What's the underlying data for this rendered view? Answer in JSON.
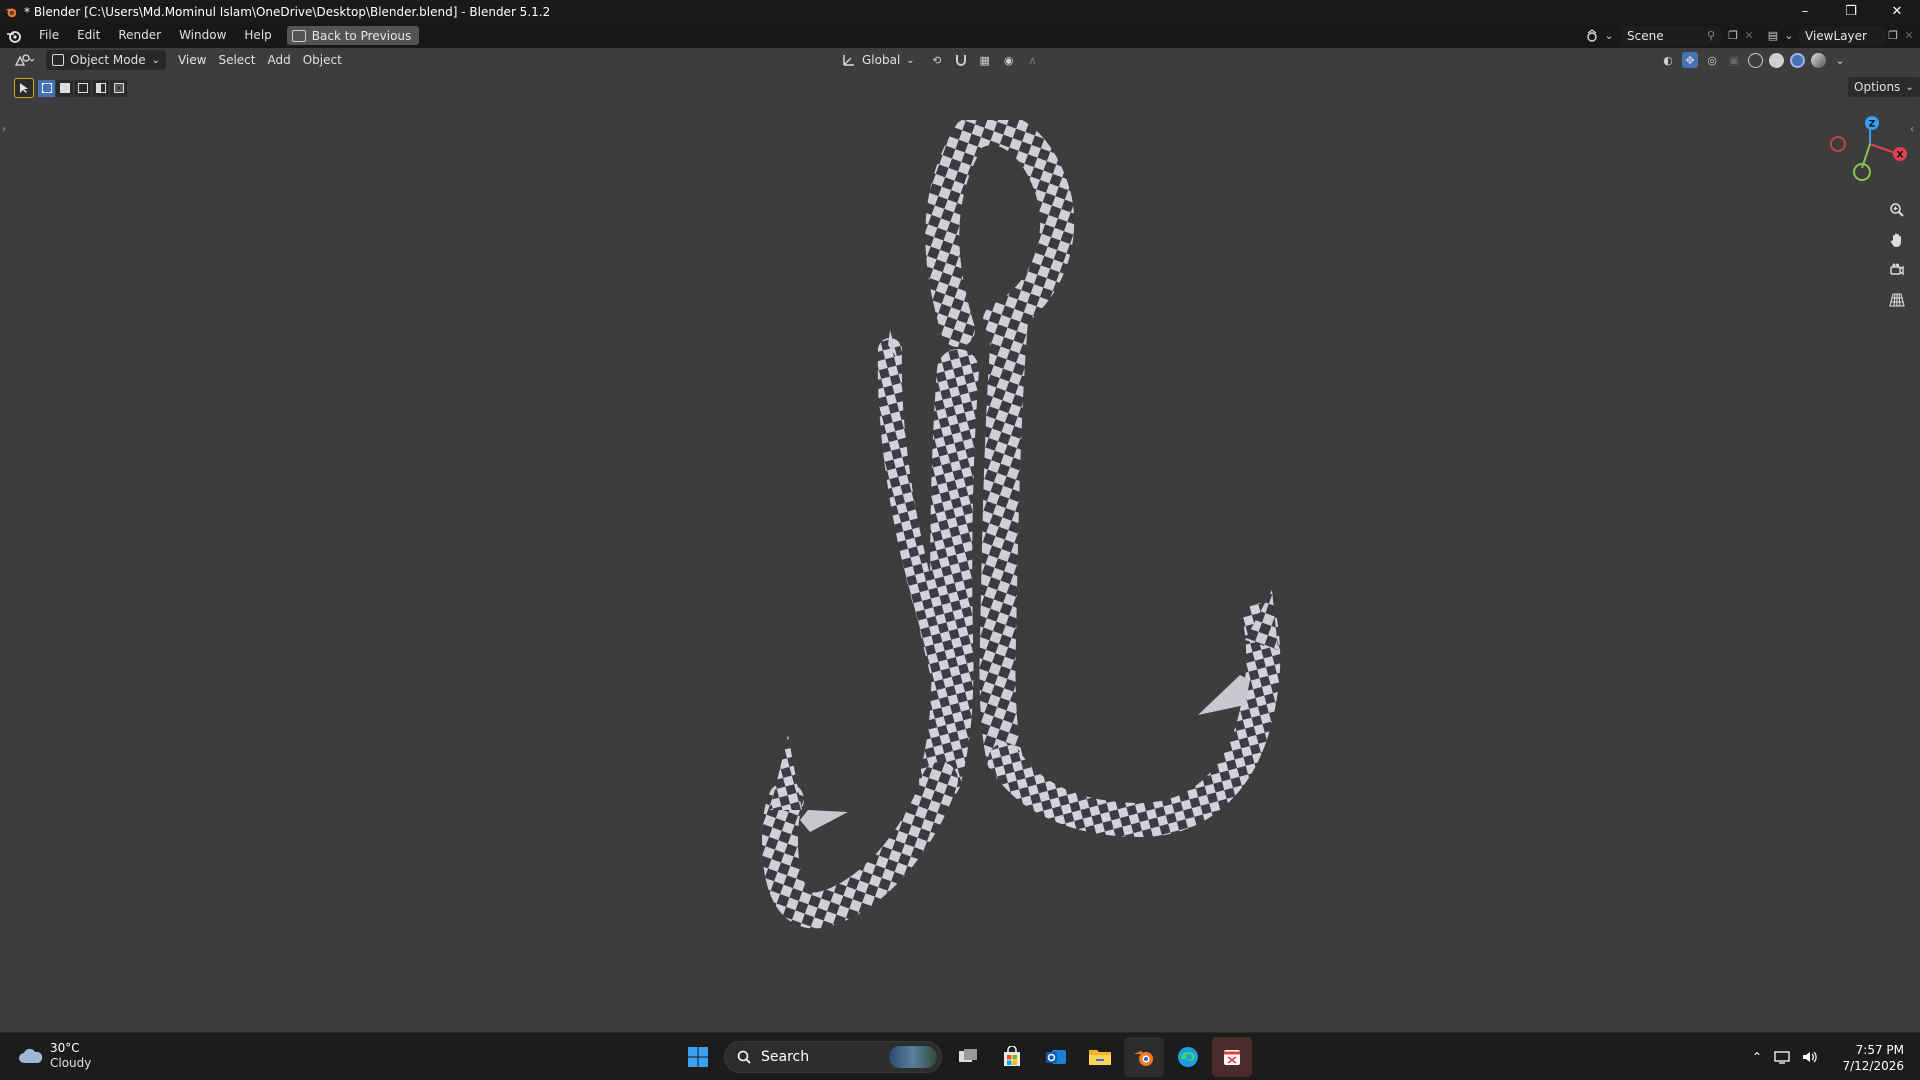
{
  "window": {
    "title": "* Blender [C:\\Users\\Md.Mominul Islam\\OneDrive\\Desktop\\Blender.blend] - Blender 5.1.2",
    "controls": {
      "minimize": "–",
      "restore": "❐",
      "close": "✕"
    }
  },
  "topbar": {
    "menus": [
      "File",
      "Edit",
      "Render",
      "Window",
      "Help"
    ],
    "back_button": "Back to Previous",
    "scene": "Scene",
    "view_layer": "ViewLayer"
  },
  "viewport_header": {
    "mode": "Object Mode",
    "menus": [
      "View",
      "Select",
      "Add",
      "Object"
    ],
    "transform_orientation": "Global"
  },
  "toolbar": {
    "options": "Options"
  },
  "gizmo": {
    "axes": {
      "x": "X",
      "y": "Y",
      "z": "Z"
    },
    "colors": {
      "x": "#e2424d",
      "y": "#8bc34a",
      "z": "#3b9cf2"
    }
  },
  "taskbar": {
    "weather": {
      "temp": "30°C",
      "condition": "Cloudy"
    },
    "search_placeholder": "Search",
    "clock": {
      "time": "7:57 PM",
      "date": "7/12/2026"
    },
    "apps": [
      "start-icon",
      "task-view-icon",
      "store-icon",
      "outlook-icon",
      "file-explorer-icon",
      "blender-icon",
      "edge-icon",
      "snipping-tool-icon"
    ]
  },
  "colors": {
    "viewport_bg": "#3d3d3d",
    "header_bg": "#181818",
    "accent_blue": "#4772b3",
    "checker_light": "#cfcfd6",
    "checker_dark": "#3a3a42"
  }
}
